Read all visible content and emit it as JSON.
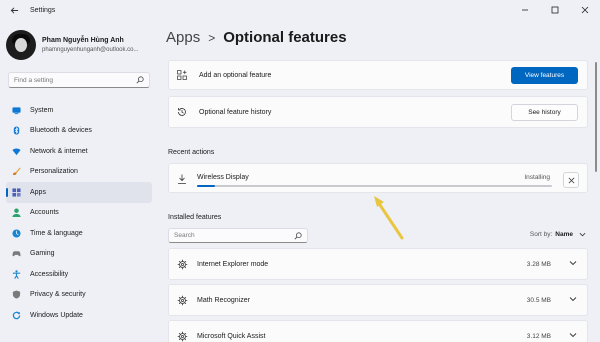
{
  "window": {
    "title": "Settings"
  },
  "profile": {
    "name": "Pham Nguyễn Hùng Anh",
    "email": "phamnguyenhunganh@outlook.co..."
  },
  "sidebar": {
    "search_placeholder": "Find a setting",
    "items": [
      {
        "label": "System",
        "icon": "monitor-icon",
        "color": "#0f78d4"
      },
      {
        "label": "Bluetooth & devices",
        "icon": "bluetooth-icon",
        "color": "#0f78d4"
      },
      {
        "label": "Network & internet",
        "icon": "wifi-icon",
        "color": "#0f78d4"
      },
      {
        "label": "Personalization",
        "icon": "brush-icon",
        "color": "#e8a33d"
      },
      {
        "label": "Apps",
        "icon": "apps-icon",
        "color": "#4a5fb5",
        "active": true
      },
      {
        "label": "Accounts",
        "icon": "person-icon",
        "color": "#2aa36b"
      },
      {
        "label": "Time & language",
        "icon": "globe-icon",
        "color": "#1a86d1"
      },
      {
        "label": "Gaming",
        "icon": "gamepad-icon",
        "color": "#7a7a7a"
      },
      {
        "label": "Accessibility",
        "icon": "accessibility-icon",
        "color": "#1a86d1"
      },
      {
        "label": "Privacy & security",
        "icon": "shield-icon",
        "color": "#7a7a7a"
      },
      {
        "label": "Windows Update",
        "icon": "update-icon",
        "color": "#1a86d1"
      }
    ]
  },
  "breadcrumb": {
    "parent": "Apps",
    "separator": ">",
    "current": "Optional features"
  },
  "add_feature": {
    "label": "Add an optional feature",
    "button": "View features"
  },
  "history": {
    "label": "Optional feature history",
    "button": "See history"
  },
  "recent": {
    "title": "Recent actions",
    "item": {
      "name": "Wireless Display",
      "status": "Installing",
      "progress": 0.05
    }
  },
  "installed": {
    "title": "Installed features",
    "search_placeholder": "Search",
    "sort_label": "Sort by:",
    "sort_value": "Name",
    "features": [
      {
        "name": "Internet Explorer mode",
        "size": "3.28 MB"
      },
      {
        "name": "Math Recognizer",
        "size": "30.5 MB"
      },
      {
        "name": "Microsoft Quick Assist",
        "size": "3.12 MB"
      }
    ]
  },
  "colors": {
    "accent": "#0067c0",
    "annotation_arrow": "#e9c642"
  }
}
